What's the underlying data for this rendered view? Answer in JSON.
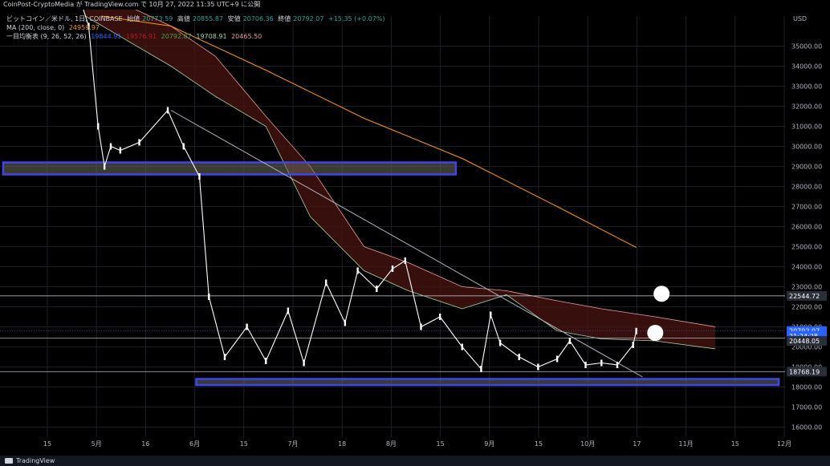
{
  "header": {
    "attribution": "CoinPost-CryptoMedia が TradingView.com で 10月 27, 2022 11:35 UTC+9 に公開"
  },
  "legend": {
    "symbol": "ビットコイン／米ドル, 1日, COINBASE",
    "open_label": "始値",
    "open": "20773.59",
    "high_label": "高値",
    "high": "20855.87",
    "low_label": "安値",
    "low": "20706.36",
    "close_label": "終値",
    "close": "20792.07",
    "change": "+15.35 (+0.07%)",
    "ma_label": "MA (200, close, 0)",
    "ma_value": "24959.97",
    "ichimoku_label": "一目均衡表 (9, 26, 52, 26)",
    "ichimoku_values": [
      "19844.91",
      "19576.91",
      "20792.07",
      "19708.91",
      "20465.50"
    ]
  },
  "footer": {
    "brand": "TradingView"
  },
  "colors": {
    "background": "#000000",
    "up_candle": "#ffffff",
    "down_candle": "#ffffff",
    "tenkan": "#2962ff",
    "kijun": "#b71c1c",
    "chikou": "#43a047",
    "span_a": "#a5d6a7",
    "span_b": "#ef9a9a",
    "ma": "#ff9800",
    "zone": "#3d46e8",
    "trendline": "#b2b5be"
  },
  "chart_data": {
    "type": "line",
    "title": "ビットコイン／米ドル, 1日, COINBASE",
    "currency": "USD",
    "xlabel": "",
    "ylabel": "",
    "ylim": [
      15500,
      36500
    ],
    "grid": true,
    "y_ticks": [
      "35000.00",
      "34000.00",
      "33000.00",
      "32000.00",
      "31000.00",
      "30000.00",
      "29000.00",
      "28000.00",
      "27000.00",
      "26000.00",
      "25000.00",
      "24000.00",
      "23000.00",
      "22000.00",
      "21000.00",
      "20000.00",
      "19000.00",
      "18000.00",
      "17000.00",
      "16000.00"
    ],
    "x_ticks": [
      "15",
      "5月",
      "16",
      "6月",
      "15",
      "7月",
      "18",
      "8月",
      "15",
      "9月",
      "15",
      "10月",
      "17",
      "11月",
      "15",
      "12月"
    ],
    "close_series": {
      "x": [
        "2022-04-15",
        "2022-04-25",
        "2022-05-01",
        "2022-05-06",
        "2022-05-09",
        "2022-05-11",
        "2022-05-13",
        "2022-05-16",
        "2022-05-22",
        "2022-05-31",
        "2022-06-05",
        "2022-06-10",
        "2022-06-13",
        "2022-06-18",
        "2022-06-25",
        "2022-07-01",
        "2022-07-08",
        "2022-07-13",
        "2022-07-20",
        "2022-07-26",
        "2022-07-30",
        "2022-08-05",
        "2022-08-10",
        "2022-08-14",
        "2022-08-19",
        "2022-08-25",
        "2022-09-01",
        "2022-09-07",
        "2022-09-10",
        "2022-09-13",
        "2022-09-19",
        "2022-09-25",
        "2022-10-01",
        "2022-10-05",
        "2022-10-10",
        "2022-10-15",
        "2022-10-20",
        "2022-10-25",
        "2022-10-26"
      ],
      "values": [
        40500,
        38000,
        38500,
        36000,
        31000,
        29000,
        30000,
        29800,
        30200,
        31800,
        30000,
        28500,
        22500,
        19500,
        21000,
        19300,
        21800,
        19200,
        23200,
        21200,
        23800,
        22900,
        23900,
        24300,
        21000,
        21500,
        20000,
        18900,
        21600,
        20200,
        19500,
        19000,
        19400,
        20300,
        19100,
        19200,
        19100,
        20100,
        20790
      ]
    },
    "ma200": {
      "name": "MA (200, close, 0)",
      "x": [
        "2022-05-10",
        "2022-06-01",
        "2022-07-01",
        "2022-08-01",
        "2022-09-01",
        "2022-10-01",
        "2022-10-26"
      ],
      "values": [
        36500,
        36000,
        33800,
        31400,
        29400,
        27000,
        24960
      ]
    },
    "ichimoku": {
      "name": "一目均衡表 (9, 26, 52, 26)",
      "cloud_span_a": {
        "x": [
          "2022-05-05",
          "2022-06-01",
          "2022-06-15",
          "2022-07-01",
          "2022-07-15",
          "2022-08-01",
          "2022-08-15",
          "2022-09-01",
          "2022-09-15",
          "2022-10-01",
          "2022-10-15",
          "2022-11-01",
          "2022-11-20"
        ],
        "values": [
          36500,
          34000,
          32500,
          31000,
          26500,
          23800,
          22800,
          21900,
          22600,
          20800,
          20400,
          20300,
          19900
        ]
      },
      "cloud_span_b": {
        "x": [
          "2022-05-05",
          "2022-06-01",
          "2022-06-15",
          "2022-07-01",
          "2022-07-15",
          "2022-08-01",
          "2022-08-15",
          "2022-09-01",
          "2022-09-15",
          "2022-10-01",
          "2022-10-15",
          "2022-11-01",
          "2022-11-20"
        ],
        "values": [
          38000,
          36000,
          34500,
          31500,
          29000,
          25000,
          24200,
          23000,
          22800,
          22300,
          21900,
          21500,
          21000
        ]
      }
    },
    "trendline": {
      "x": [
        "2022-06-01",
        "2022-10-28"
      ],
      "values": [
        31800,
        18500
      ]
    },
    "zones": [
      {
        "x": [
          "2022-04-09",
          "2022-08-30"
        ],
        "values": [
          28600,
          29200
        ]
      },
      {
        "x": [
          "2022-06-09",
          "2022-12-10"
        ],
        "values": [
          18100,
          18400
        ]
      }
    ],
    "hlines": [
      22544.72,
      20448.05,
      18768.19
    ],
    "price_labels": [
      {
        "value": "22544.72",
        "y": 22544.72,
        "color": "#2a2e39",
        "text_color": "#ffffff"
      },
      {
        "value": "20792.07",
        "y": 20792.07,
        "color": "#2962ff",
        "text_color": "#ffffff"
      },
      {
        "value": "21:24:28",
        "y": 20550,
        "color": "#2962ff",
        "text_color": "#ffffff"
      },
      {
        "value": "20448.05",
        "y": 20300,
        "color": "#2a2e39",
        "text_color": "#ffffff"
      },
      {
        "value": "18768.19",
        "y": 18768.19,
        "color": "#2a2e39",
        "text_color": "#ffffff"
      }
    ],
    "annotations": [
      {
        "text": "❶",
        "x": "2022-11-01",
        "y": 20700
      },
      {
        "text": "❷",
        "x": "2022-11-03",
        "y": 22650
      }
    ]
  }
}
